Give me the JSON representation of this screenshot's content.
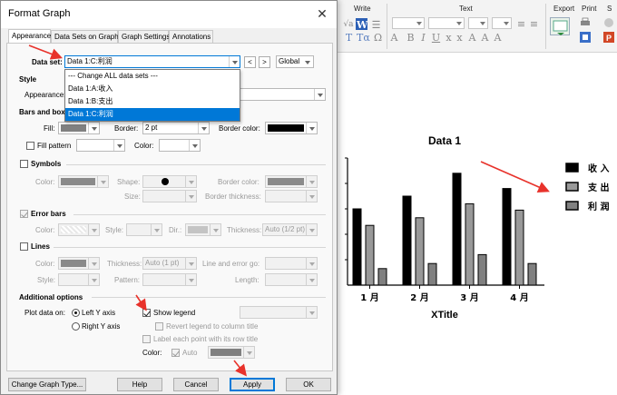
{
  "ribbon": {
    "groups": [
      "Write",
      "Text",
      "Export",
      "Print",
      "S"
    ],
    "buttons": [
      "√a",
      "W",
      "T",
      "Tα",
      "A",
      "B",
      "I",
      "U",
      "x",
      "x",
      "A",
      "A",
      "A"
    ]
  },
  "dialog": {
    "title": "Format Graph",
    "close_glyph": "✕",
    "tabs": [
      "Appearance",
      "Data Sets on Graph",
      "Graph Settings",
      "Annotations"
    ],
    "dataset_label": "Data set:",
    "dataset_value": "Data 1:C:利润",
    "prev_glyph": "<",
    "next_glyph": ">",
    "global_value": "Global",
    "dropdown_items": [
      "--- Change ALL data sets ---",
      "Data 1:A:收入",
      "Data 1:B:支出",
      "Data 1:C:利润"
    ],
    "style_header": "Style",
    "appearance_label": "Appearance:",
    "bars_header": "Bars and box",
    "fill_label": "Fill:",
    "border_label": "Border:",
    "border_value": "2 pt",
    "border_color_label": "Border color:",
    "fill_pattern_label": "Fill pattern",
    "color_label": "Color:",
    "symbols_header": "Symbols",
    "sym_color_label": "Color:",
    "shape_label": "Shape:",
    "size_label": "Size:",
    "sym_border_color_label": "Border color:",
    "border_thickness_label": "Border thickness:",
    "error_bars_header": "Error bars",
    "eb_color_label": "Color:",
    "eb_style_label": "Style:",
    "dir_label": "Dir.:",
    "eb_thickness_label": "Thickness:",
    "eb_thickness_value": "Auto (1/2 pt)",
    "lines_header": "Lines",
    "ln_color_label": "Color:",
    "ln_thickness_label": "Thickness:",
    "ln_thickness_value": "Auto (1 pt)",
    "line_error_label": "Line and error go:",
    "ln_style_label": "Style:",
    "pattern_label": "Pattern:",
    "length_label": "Length:",
    "additional_header": "Additional options",
    "plot_on_label": "Plot data on:",
    "left_axis_label": "Left Y axis",
    "right_axis_label": "Right  Y axis",
    "show_legend_label": "Show legend",
    "revert_legend_label": "Revert legend to column title",
    "label_each_label": "Label each point with its row title",
    "legend_color_label": "Color:",
    "auto_label": "Auto",
    "change_type_button": "Change Graph Type...",
    "help_button": "Help",
    "cancel_button": "Cancel",
    "apply_button": "Apply",
    "ok_button": "OK"
  },
  "colors": {
    "fill": "#808080",
    "border_color": "#000000",
    "highlight": "#0078d7",
    "annotation_arrow": "#e8322b"
  },
  "chart_data": {
    "type": "bar",
    "title": "Data 1",
    "xlabel": "XTitle",
    "categories": [
      "1 月",
      "2 月",
      "3 月",
      "4 月"
    ],
    "series": [
      {
        "name": "收 入",
        "values": [
          6.0,
          7.0,
          8.8,
          7.6
        ],
        "color": "#000000"
      },
      {
        "name": "支 出",
        "values": [
          4.7,
          5.3,
          6.4,
          5.9
        ],
        "color": "#999999"
      },
      {
        "name": "利 润",
        "values": [
          1.3,
          1.7,
          2.4,
          1.7
        ],
        "color": "#808080"
      }
    ],
    "ylim": [
      0,
      10
    ],
    "legend": "right",
    "grid": false
  }
}
